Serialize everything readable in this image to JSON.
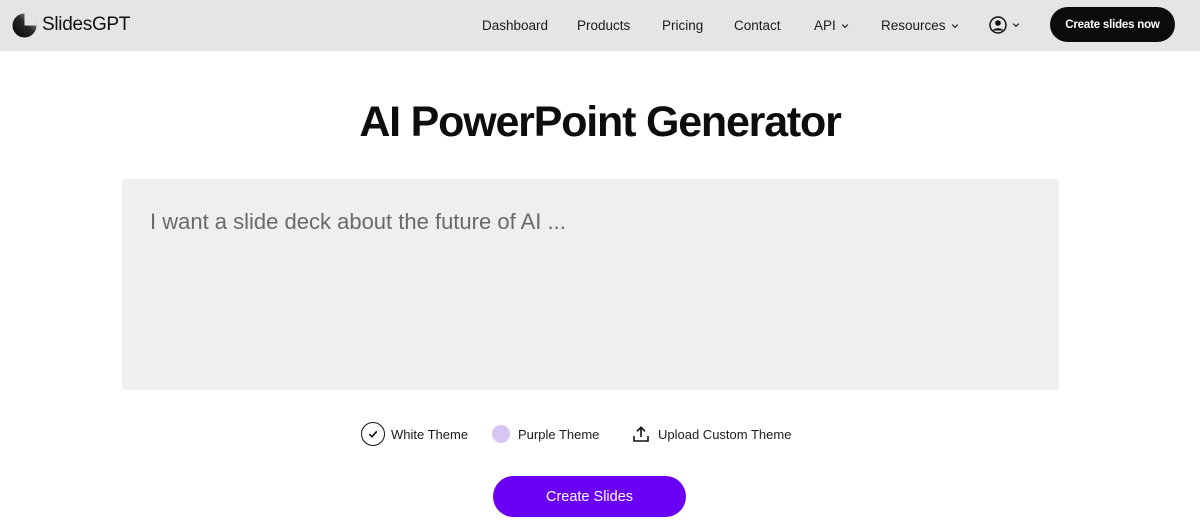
{
  "brand": {
    "name": "SlidesGPT"
  },
  "nav": {
    "items": [
      {
        "label": "Dashboard"
      },
      {
        "label": "Products"
      },
      {
        "label": "Pricing"
      },
      {
        "label": "Contact"
      },
      {
        "label": "API",
        "dropdown": true
      },
      {
        "label": "Resources",
        "dropdown": true
      }
    ],
    "account_icon": "user-circle-icon",
    "cta_label": "Create slides now"
  },
  "hero": {
    "title": "AI PowerPoint Generator"
  },
  "prompt": {
    "placeholder": "I want a slide deck about the future of AI ...",
    "value": ""
  },
  "themes": {
    "white": {
      "label": "White Theme",
      "selected": true,
      "icon": "check-circle-icon"
    },
    "purple": {
      "label": "Purple Theme",
      "selected": false,
      "color": "#d8c4f5"
    },
    "upload": {
      "label": "Upload Custom Theme",
      "icon": "upload-icon"
    }
  },
  "create_button": {
    "label": "Create Slides",
    "color": "#6a00f4"
  },
  "colors": {
    "navbar": "#e5e5e5",
    "accent": "#6a00f4",
    "cta": "#0b0b0b",
    "prompt_bg": "#efefef"
  }
}
